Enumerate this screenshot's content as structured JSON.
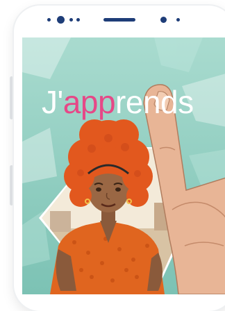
{
  "app": {
    "title_prefix": "J'",
    "title_highlight": "app",
    "title_suffix": "rends"
  },
  "colors": {
    "screen_background": "#9fd5c8",
    "title_white": "#ffffff",
    "title_accent": "#e64887",
    "phone_frame": "#ffffff",
    "phone_detail": "#1e3d78"
  },
  "icons": {
    "front_camera": "camera-icon",
    "earpiece": "speaker-icon",
    "sensor": "sensor-icon"
  }
}
